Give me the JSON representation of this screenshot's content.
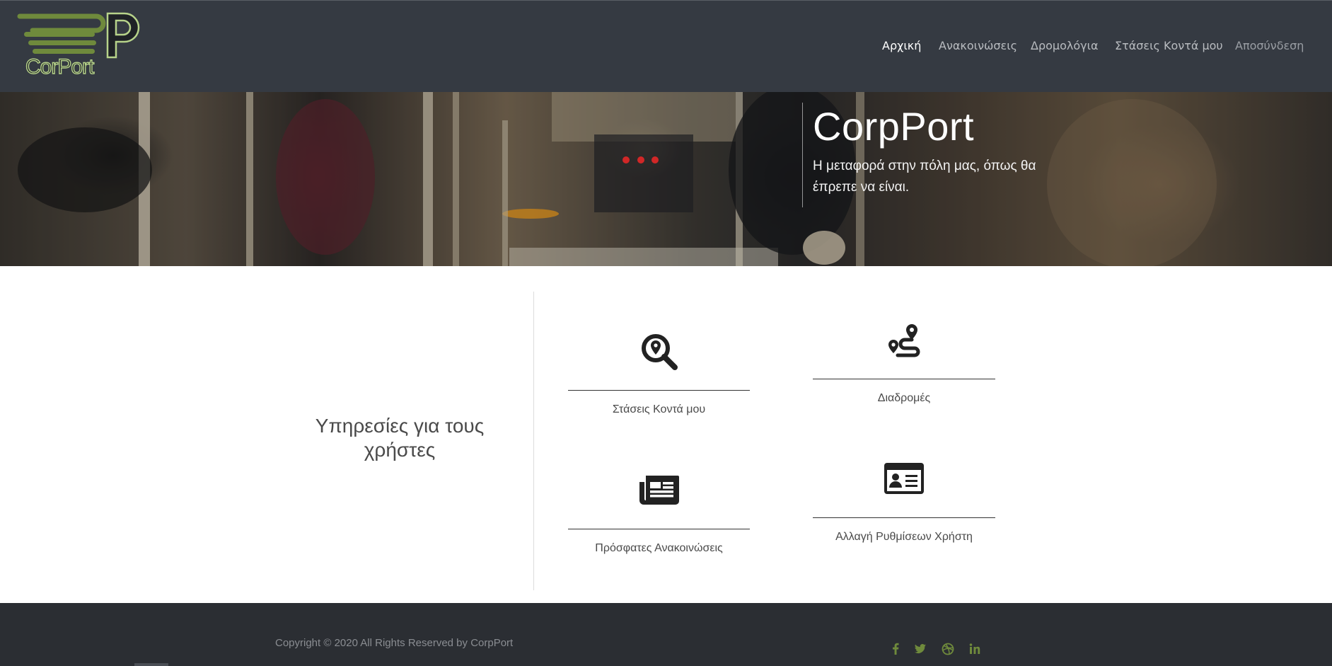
{
  "header": {
    "logo_text": "CorPort",
    "nav": [
      {
        "label": "Αρχική",
        "active": true
      },
      {
        "label": "Ανακοινώσεις",
        "active": false
      },
      {
        "label": "Δρομολόγια",
        "active": false
      },
      {
        "label": "Στάσεις Κοντά μου",
        "active": false
      }
    ],
    "logout_label": "Αποσύνδεση"
  },
  "hero": {
    "title": "CorpPort",
    "subtitle": "Η μεταφορά στην πόλη μας, όπως θα έπρεπε να είναι."
  },
  "services": {
    "title": "Υπηρεσίες για τους χρήστες",
    "items": [
      {
        "label": "Στάσεις Κοντά μου",
        "icon": "search-location-icon"
      },
      {
        "label": "Διαδρομές",
        "icon": "route-icon"
      },
      {
        "label": "Πρόσφατες Ανακοινώσεις",
        "icon": "newspaper-icon"
      },
      {
        "label": "Αλλαγή Ρυθμίσεων Χρήστη",
        "icon": "id-card-icon"
      }
    ]
  },
  "footer": {
    "copyright": "Copyright © 2020 All Rights Reserved by CorpPort",
    "social": [
      "facebook-icon",
      "twitter-icon",
      "dribbble-icon",
      "linkedin-icon"
    ],
    "social_color": "#6f8a3c"
  },
  "colors": {
    "header_bg": "#353a42",
    "footer_bg": "#2b2e33",
    "logo_green": "#6f8a3c"
  }
}
